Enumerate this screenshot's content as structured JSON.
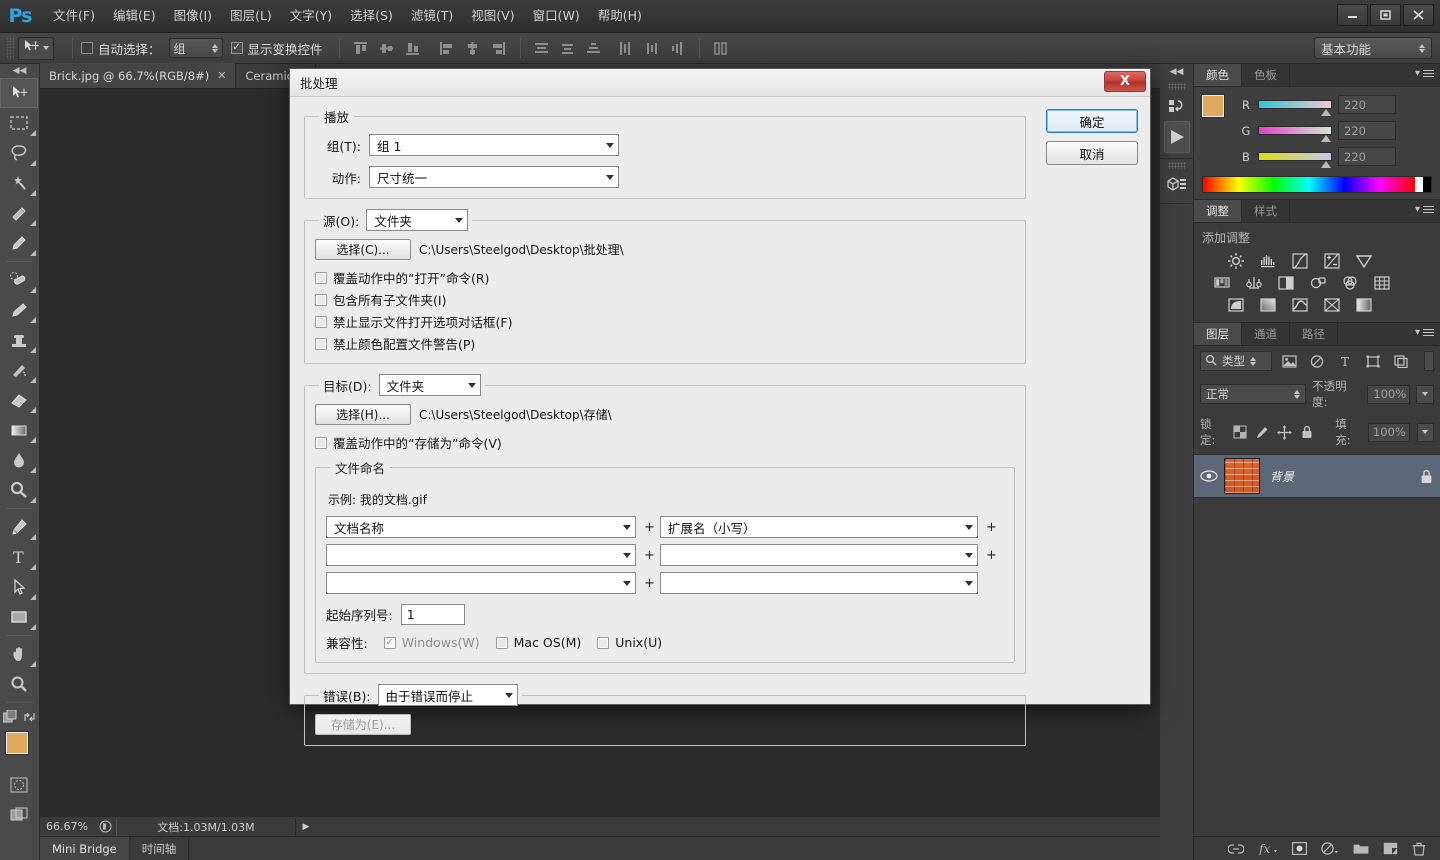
{
  "app": {
    "logo": "Ps",
    "menus": [
      "文件(F)",
      "编辑(E)",
      "图像(I)",
      "图层(L)",
      "文字(Y)",
      "选择(S)",
      "滤镜(T)",
      "视图(V)",
      "窗口(W)",
      "帮助(H)"
    ],
    "window_controls": {
      "minimize": "—",
      "maximize": "❐",
      "close": "✕"
    }
  },
  "options_bar": {
    "auto_select_label": "自动选择：",
    "auto_select_value": "组",
    "show_transform_label": "显示变换控件",
    "workspace": "基本功能"
  },
  "document_tabs": [
    {
      "label": "Brick.jpg @ 66.7%(RGB/8#)",
      "close": "✕",
      "active": true
    },
    {
      "label": "Ceramics.j",
      "close": "✕",
      "active": false
    }
  ],
  "status_bar": {
    "zoom": "66.67%",
    "doc_info": "文档:1.03M/1.03M",
    "arrow": "▶"
  },
  "bottom_tabs": [
    {
      "label": "Mini Bridge",
      "active": true
    },
    {
      "label": "时间轴",
      "active": false
    }
  ],
  "panels": {
    "color": {
      "tabs": [
        {
          "label": "颜色",
          "active": true
        },
        {
          "label": "色板",
          "active": false
        }
      ],
      "channels": [
        {
          "label": "R",
          "value": "220"
        },
        {
          "label": "G",
          "value": "220"
        },
        {
          "label": "B",
          "value": "220"
        }
      ],
      "foreground_color": "#dfa95e",
      "background_color": "#dcdcdc"
    },
    "adjustments": {
      "tabs": [
        {
          "label": "调整",
          "active": true
        },
        {
          "label": "样式",
          "active": false
        }
      ],
      "title": "添加调整",
      "icons": [
        "brightness-icon",
        "levels-icon",
        "curves-icon",
        "exposure-icon",
        "vibrance-icon",
        "hue-saturation-icon",
        "color-balance-icon",
        "black-white-icon",
        "photo-filter-icon",
        "channel-mixer-icon",
        "color-lookup-icon",
        "invert-icon",
        "posterize-icon",
        "threshold-icon",
        "selective-color-icon",
        "gradient-map-icon"
      ]
    },
    "layers": {
      "tabs": [
        {
          "label": "图层",
          "active": true
        },
        {
          "label": "通道",
          "active": false
        },
        {
          "label": "路径",
          "active": false
        }
      ],
      "filter_label": "类型",
      "blend_mode": "正常",
      "opacity_label": "不透明度:",
      "opacity_value": "100%",
      "lock_label": "锁定:",
      "fill_label": "填充:",
      "fill_value": "100%",
      "rows": [
        {
          "name": "背景",
          "locked": true,
          "visible": true
        }
      ],
      "bottom_icons": [
        "link-icon",
        "fx-icon",
        "mask-icon",
        "adjustment-icon",
        "folder-icon",
        "new-layer-icon",
        "delete-icon"
      ]
    }
  },
  "toolbar": {
    "tools": [
      "move-tool",
      "marquee-tool",
      "lasso-tool",
      "magic-wand-tool",
      "crop-tool",
      "eyedropper-tool",
      "healing-brush-tool",
      "brush-tool",
      "clone-stamp-tool",
      "history-brush-tool",
      "eraser-tool",
      "gradient-tool",
      "blur-tool",
      "dodge-tool",
      "pen-tool",
      "type-tool",
      "path-selection-tool",
      "rectangle-tool",
      "hand-tool",
      "zoom-tool"
    ]
  },
  "dialog": {
    "title": "批处理",
    "close_label": "X",
    "ok_label": "确定",
    "cancel_label": "取消",
    "play": {
      "legend": "播放",
      "set_label": "组(T):",
      "set_value": "组 1",
      "action_label": "动作:",
      "action_value": "尺寸统一"
    },
    "source": {
      "legend_label": "源(O):",
      "legend_value": "文件夹",
      "choose_button": "选择(C)...",
      "path": "C:\\Users\\Steelgod\\Desktop\\批处理\\",
      "checkboxes": [
        {
          "label": "覆盖动作中的“打开”命令(R)",
          "checked": false
        },
        {
          "label": "包含所有子文件夹(I)",
          "checked": false
        },
        {
          "label": "禁止显示文件打开选项对话框(F)",
          "checked": false
        },
        {
          "label": "禁止颜色配置文件警告(P)",
          "checked": false
        }
      ]
    },
    "destination": {
      "legend_label": "目标(D):",
      "legend_value": "文件夹",
      "choose_button": "选择(H)...",
      "path": "C:\\Users\\Steelgod\\Desktop\\存储\\",
      "override_checkbox": {
        "label": "覆盖动作中的“存储为”命令(V)",
        "checked": false
      },
      "file_naming": {
        "legend": "文件命名",
        "example_label": "示例: 我的文档.gif",
        "fields": [
          {
            "left": "文档名称",
            "plus": "+",
            "right": "扩展名（小写）",
            "trailing_plus": "+"
          },
          {
            "left": "",
            "plus": "+",
            "right": "",
            "trailing_plus": "+"
          },
          {
            "left": "",
            "plus": "+",
            "right": "",
            "trailing_plus": ""
          }
        ],
        "serial_label": "起始序列号:",
        "serial_value": "1",
        "compat_label": "兼容性:",
        "compat": [
          {
            "label": "Windows(W)",
            "checked": true,
            "disabled": true
          },
          {
            "label": "Mac OS(M)",
            "checked": false,
            "disabled": false
          },
          {
            "label": "Unix(U)",
            "checked": false,
            "disabled": false
          }
        ]
      }
    },
    "errors": {
      "legend_label": "错误(B):",
      "legend_value": "由于错误而停止",
      "save_as_button": "存储为(E)..."
    }
  },
  "colors": {
    "accent_blue": "#2ba7e0",
    "dialog_bg": "#ececec",
    "panel_bg": "#3b3b3b",
    "layer_selected": "#5c6878",
    "close_red": "#c44238"
  }
}
